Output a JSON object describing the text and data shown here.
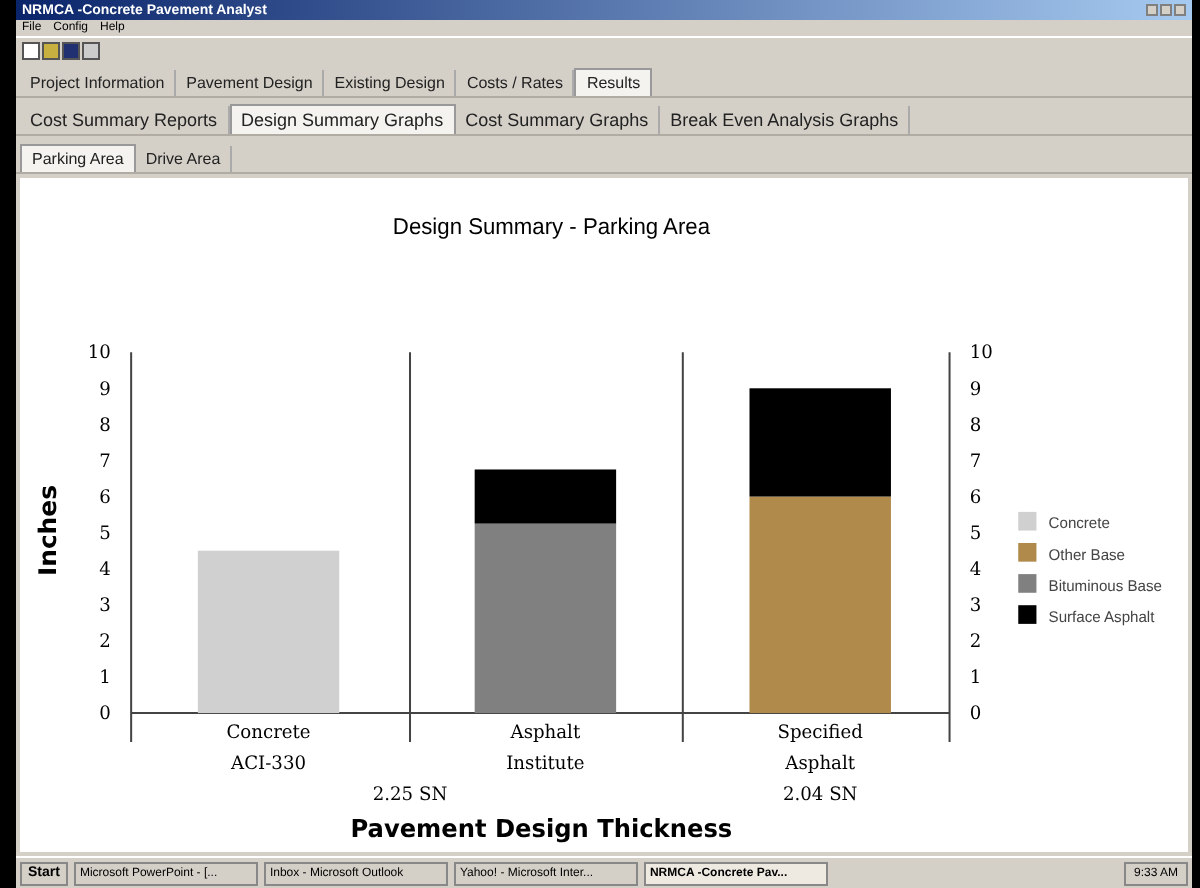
{
  "window": {
    "title": "NRMCA -Concrete Pavement Analyst"
  },
  "menu": [
    "File",
    "Config",
    "Help"
  ],
  "tabs": [
    {
      "label": "Project Information",
      "selected": false
    },
    {
      "label": "Pavement Design",
      "selected": false
    },
    {
      "label": "Existing Design",
      "selected": false
    },
    {
      "label": "Costs / Rates",
      "selected": false
    },
    {
      "label": "Results",
      "selected": true
    }
  ],
  "subtabs": [
    {
      "label": "Cost Summary Reports",
      "selected": false
    },
    {
      "label": "Design Summary Graphs",
      "selected": true
    },
    {
      "label": "Cost Summary Graphs",
      "selected": false
    },
    {
      "label": "Break Even Analysis Graphs",
      "selected": false
    }
  ],
  "area_tabs": [
    {
      "label": "Parking Area",
      "selected": true
    },
    {
      "label": "Drive Area",
      "selected": false
    }
  ],
  "chart": {
    "chart_data": {
      "type": "bar",
      "stacked": true,
      "title": "Design Summary - Parking Area",
      "xlabel": "Pavement Design Thickness",
      "ylabel": "Inches",
      "categories": [
        "Concrete\nACI-330",
        "Asphalt\nInstitute",
        "Specified\nAsphalt\n2.04 SN"
      ],
      "ylim": [
        0,
        10
      ],
      "yticks": [
        0,
        1,
        2,
        3,
        4,
        5,
        6,
        7,
        8,
        9,
        10
      ],
      "series": [
        {
          "name": "Concrete",
          "color": "#d0d0d0",
          "values": [
            4.5,
            0,
            0
          ]
        },
        {
          "name": "Other Base",
          "color": "#b08a4a",
          "values": [
            0,
            0,
            6
          ]
        },
        {
          "name": "Bituminous Base",
          "color": "#808080",
          "values": [
            0,
            5.25,
            0
          ]
        },
        {
          "name": "Surface Asphalt",
          "color": "#000000",
          "values": [
            0,
            1.5,
            3
          ]
        }
      ],
      "annotations": [
        "2.25 SN"
      ],
      "legend": "right"
    },
    "left_axis_ticks": [
      "10",
      "9",
      "8",
      "7",
      "6",
      "5",
      "4",
      "3",
      "2",
      "1",
      "0"
    ],
    "right_axis_ticks": [
      "10",
      "9",
      "8",
      "7",
      "6",
      "5",
      "4",
      "3",
      "2",
      "1",
      "0"
    ]
  },
  "taskbar": {
    "start": "Start",
    "items": [
      {
        "label": "Microsoft PowerPoint - [...",
        "selected": false
      },
      {
        "label": "Inbox - Microsoft Outlook",
        "selected": false
      },
      {
        "label": "Yahoo! - Microsoft Inter...",
        "selected": false
      },
      {
        "label": "NRMCA -Concrete Pav...",
        "selected": true
      }
    ],
    "clock": "9:33 AM"
  }
}
